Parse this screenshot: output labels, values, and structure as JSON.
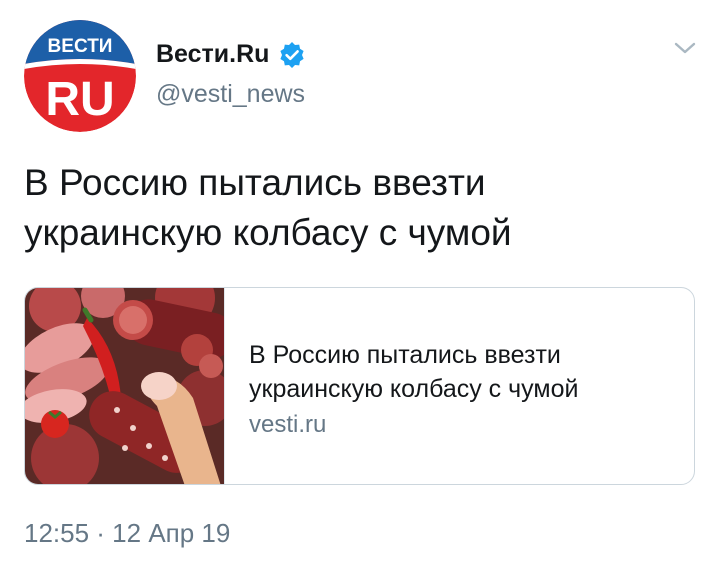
{
  "author": {
    "avatar_text_top": "ВЕСТИ",
    "avatar_text_bottom": "RU",
    "display_name": "Вести.Ru",
    "handle": "@vesti_news",
    "verified": true
  },
  "tweet": {
    "text_line1": "В Россию пытались ввезти",
    "text_line2": "украинскую колбасу с чумой"
  },
  "card": {
    "title_line1": "В Россию пытались ввезти",
    "title_line2": "украинскую колбасу с чумой",
    "domain": "vesti.ru"
  },
  "footer": {
    "timestamp": "12:55 · 12 Апр 19"
  },
  "colors": {
    "brand_blue": "#1d5fa8",
    "brand_red": "#e3262b",
    "verified_blue": "#1da1f2",
    "text_primary": "#14171a",
    "text_secondary": "#657786",
    "card_border": "#ccd6dd"
  },
  "icons": {
    "verified": "verified-badge-icon",
    "menu": "chevron-down-icon"
  }
}
